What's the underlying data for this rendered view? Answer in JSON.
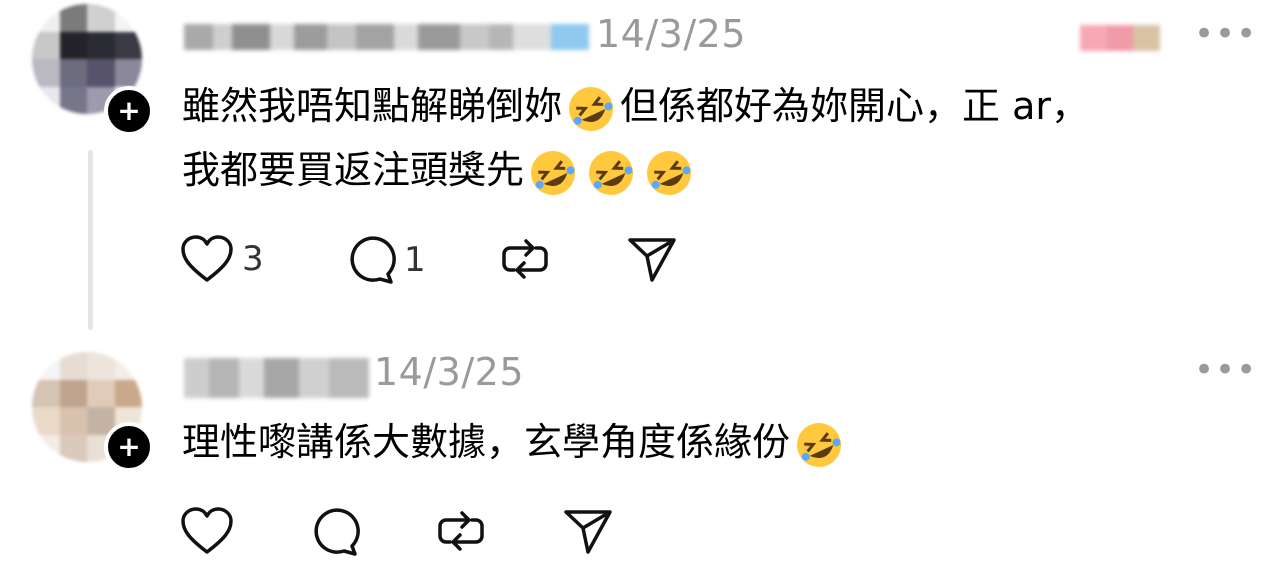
{
  "comments": [
    {
      "timestamp": "14/3/25",
      "more": "•••",
      "text_line1": "雖然我唔知點解睇倒妳",
      "text_line1b": "但係都好為妳開心，正 ar，",
      "text_line2": "我都要買返注頭獎先",
      "like_count": "3",
      "reply_count": "1",
      "emoji_name": "rolling-on-floor-laughing-emoji"
    },
    {
      "timestamp": "14/3/25",
      "more": "•••",
      "text_line1": "理性嚟講係大數據，玄學角度係緣份",
      "like_count": "",
      "reply_count": "",
      "emoji_name": "rolling-on-floor-laughing-emoji"
    }
  ],
  "colors": {
    "text": "#000000",
    "muted": "#9a9a9a",
    "thread_line": "#e4e4e4",
    "emoji_face": "#FFC83D"
  },
  "icons": [
    "heart-icon",
    "comment-icon",
    "repost-icon",
    "share-icon",
    "plus-icon",
    "more-icon"
  ]
}
